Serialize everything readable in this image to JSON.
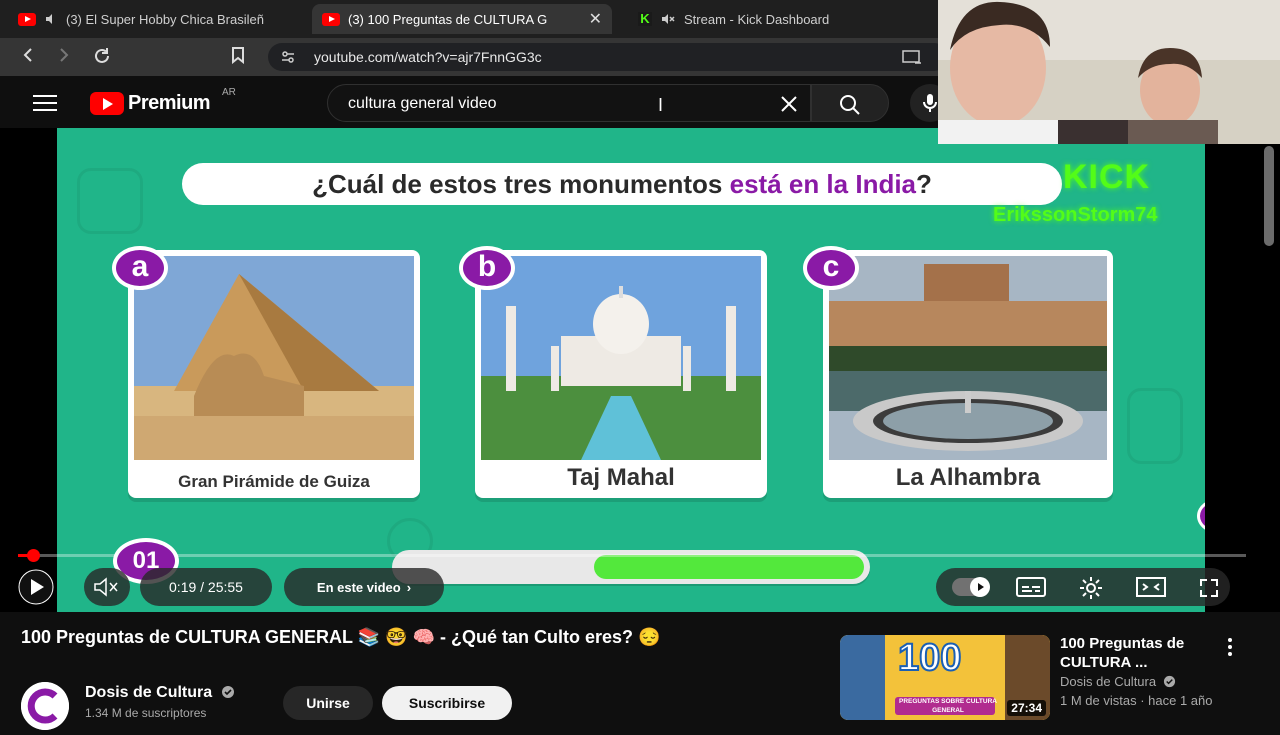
{
  "browser": {
    "tabs": [
      {
        "label": "(3) El Super Hobby Chica Brasileñ",
        "favicon": "youtube-icon",
        "muted": true
      },
      {
        "label": "(3) 100 Preguntas de CULTURA G",
        "favicon": "youtube-icon",
        "active": true
      },
      {
        "label": "Stream - Kick Dashboard",
        "favicon": "kick-icon",
        "muted": true
      }
    ],
    "close_glyph": "✕",
    "url": "youtube.com/watch?v=ajr7FnnGG3c"
  },
  "youtube": {
    "logo_text": "Premium",
    "region": "AR",
    "search_query": "cultura general video"
  },
  "video": {
    "question_prefix": "¿Cuál de estos tres monumentos ",
    "question_highlight": "está en la India",
    "question_suffix": "?",
    "options": [
      {
        "letter": "a",
        "caption": "Gran Pirámide de Guiza"
      },
      {
        "letter": "b",
        "caption": "Taj Mahal"
      },
      {
        "letter": "c",
        "caption": "La Alhambra"
      }
    ],
    "question_number": "01",
    "kick_overlay": "KICK",
    "kick_username": "ErikssonStorm74",
    "timer_fraction": 0.58,
    "progress_fraction": 0.012
  },
  "player_controls": {
    "time": "0:19 / 25:55",
    "chapters_label": "En este video",
    "chapters_chevron": "›"
  },
  "info": {
    "title": "100 Preguntas de CULTURA GENERAL 📚 🤓 🧠 - ¿Qué tan Culto eres? 😔",
    "channel_name": "Dosis de Cultura",
    "subscribers": "1.34 M de suscriptores",
    "join_label": "Unirse",
    "subscribe_label": "Suscribirse"
  },
  "recommended": {
    "title": "100 Preguntas de CULTURA ...",
    "channel": "Dosis de Cultura",
    "meta": "1 M de vistas · hace 1 año",
    "duration": "27:34",
    "thumb_number": "100",
    "thumb_text": "PREGUNTAS SOBRE CULTURA GENERAL"
  },
  "colors": {
    "video_bg": "#20b589",
    "accent_purple": "#8a1aa6",
    "kick_green": "#53fc18",
    "youtube_red": "#ff0000"
  }
}
